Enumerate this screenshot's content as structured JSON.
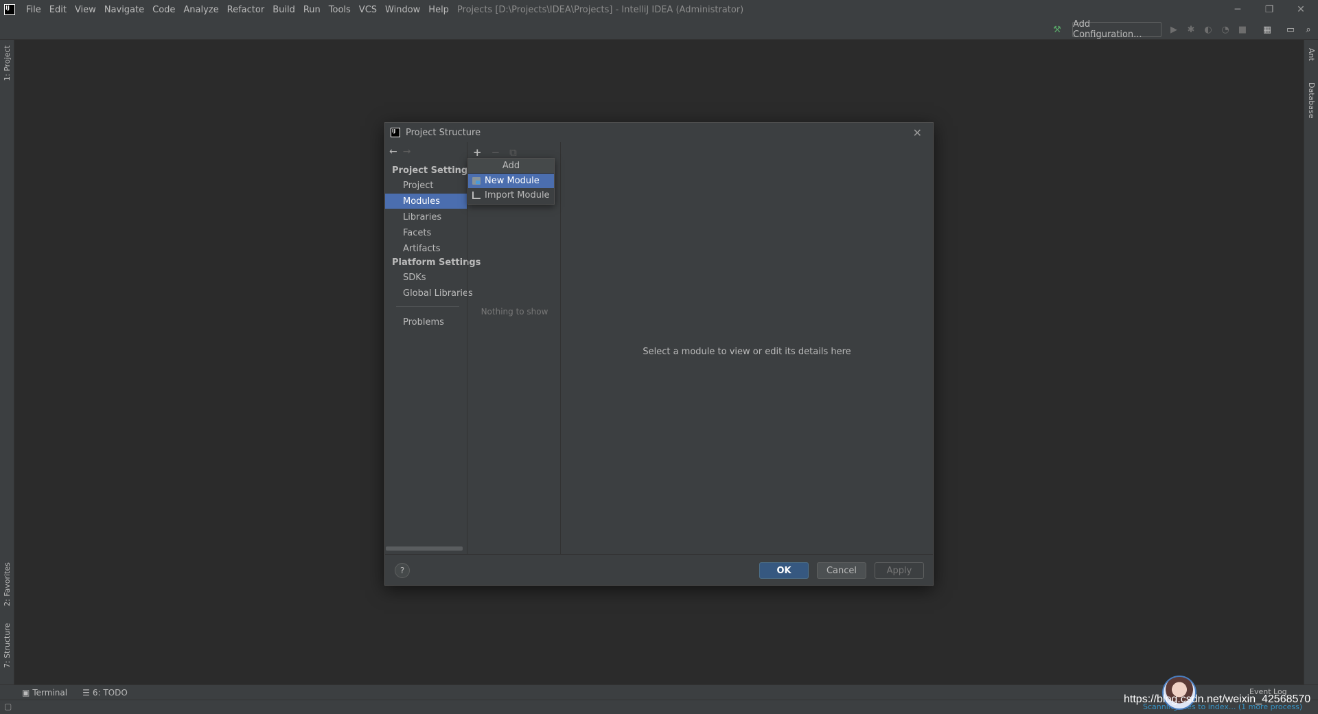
{
  "menubar": {
    "items": [
      "File",
      "Edit",
      "View",
      "Navigate",
      "Code",
      "Analyze",
      "Refactor",
      "Build",
      "Run",
      "Tools",
      "VCS",
      "Window",
      "Help"
    ],
    "window_title": "Projects [D:\\Projects\\IDEA\\Projects] - IntelliJ IDEA (Administrator)",
    "minimize": "─",
    "restore": "❐",
    "close": "✕"
  },
  "toolbar": {
    "add_configuration": "Add Configuration..."
  },
  "left_tool_tabs": {
    "project": "1: Project",
    "favorites": "2: Favorites",
    "structure": "7: Structure"
  },
  "right_tool_tabs": {
    "ant": "Ant",
    "database": "Database"
  },
  "bottom_tabs": {
    "terminal": "Terminal",
    "todo": "6: TODO"
  },
  "statusbar": {
    "event_log": "Event Log",
    "progress": "Scanning files to index... (1 more process)",
    "watermark": "https://blog.csdn.net/weixin_42568570"
  },
  "dialog": {
    "title": "Project Structure",
    "close": "✕",
    "back": "←",
    "forward": "→",
    "project_settings": "Project Settings",
    "platform_settings": "Platform Settings",
    "nav": {
      "project": "Project",
      "modules": "Modules",
      "libraries": "Libraries",
      "facets": "Facets",
      "artifacts": "Artifacts",
      "sdks": "SDKs",
      "global_libraries": "Global Libraries",
      "problems": "Problems"
    },
    "mid": {
      "add": "+",
      "remove": "−",
      "copy": "⧉",
      "empty": "Nothing to show"
    },
    "hint": "Select a module to view or edit its details here",
    "footer": {
      "help": "?",
      "ok": "OK",
      "cancel": "Cancel",
      "apply": "Apply"
    }
  },
  "popup": {
    "header": "Add",
    "new_module": "New Module",
    "import_module": "Import Module"
  },
  "colors": {
    "selection": "#4b6eaf",
    "ok_button": "#365880",
    "background": "#2b2b2b",
    "panel": "#3c3f41"
  }
}
